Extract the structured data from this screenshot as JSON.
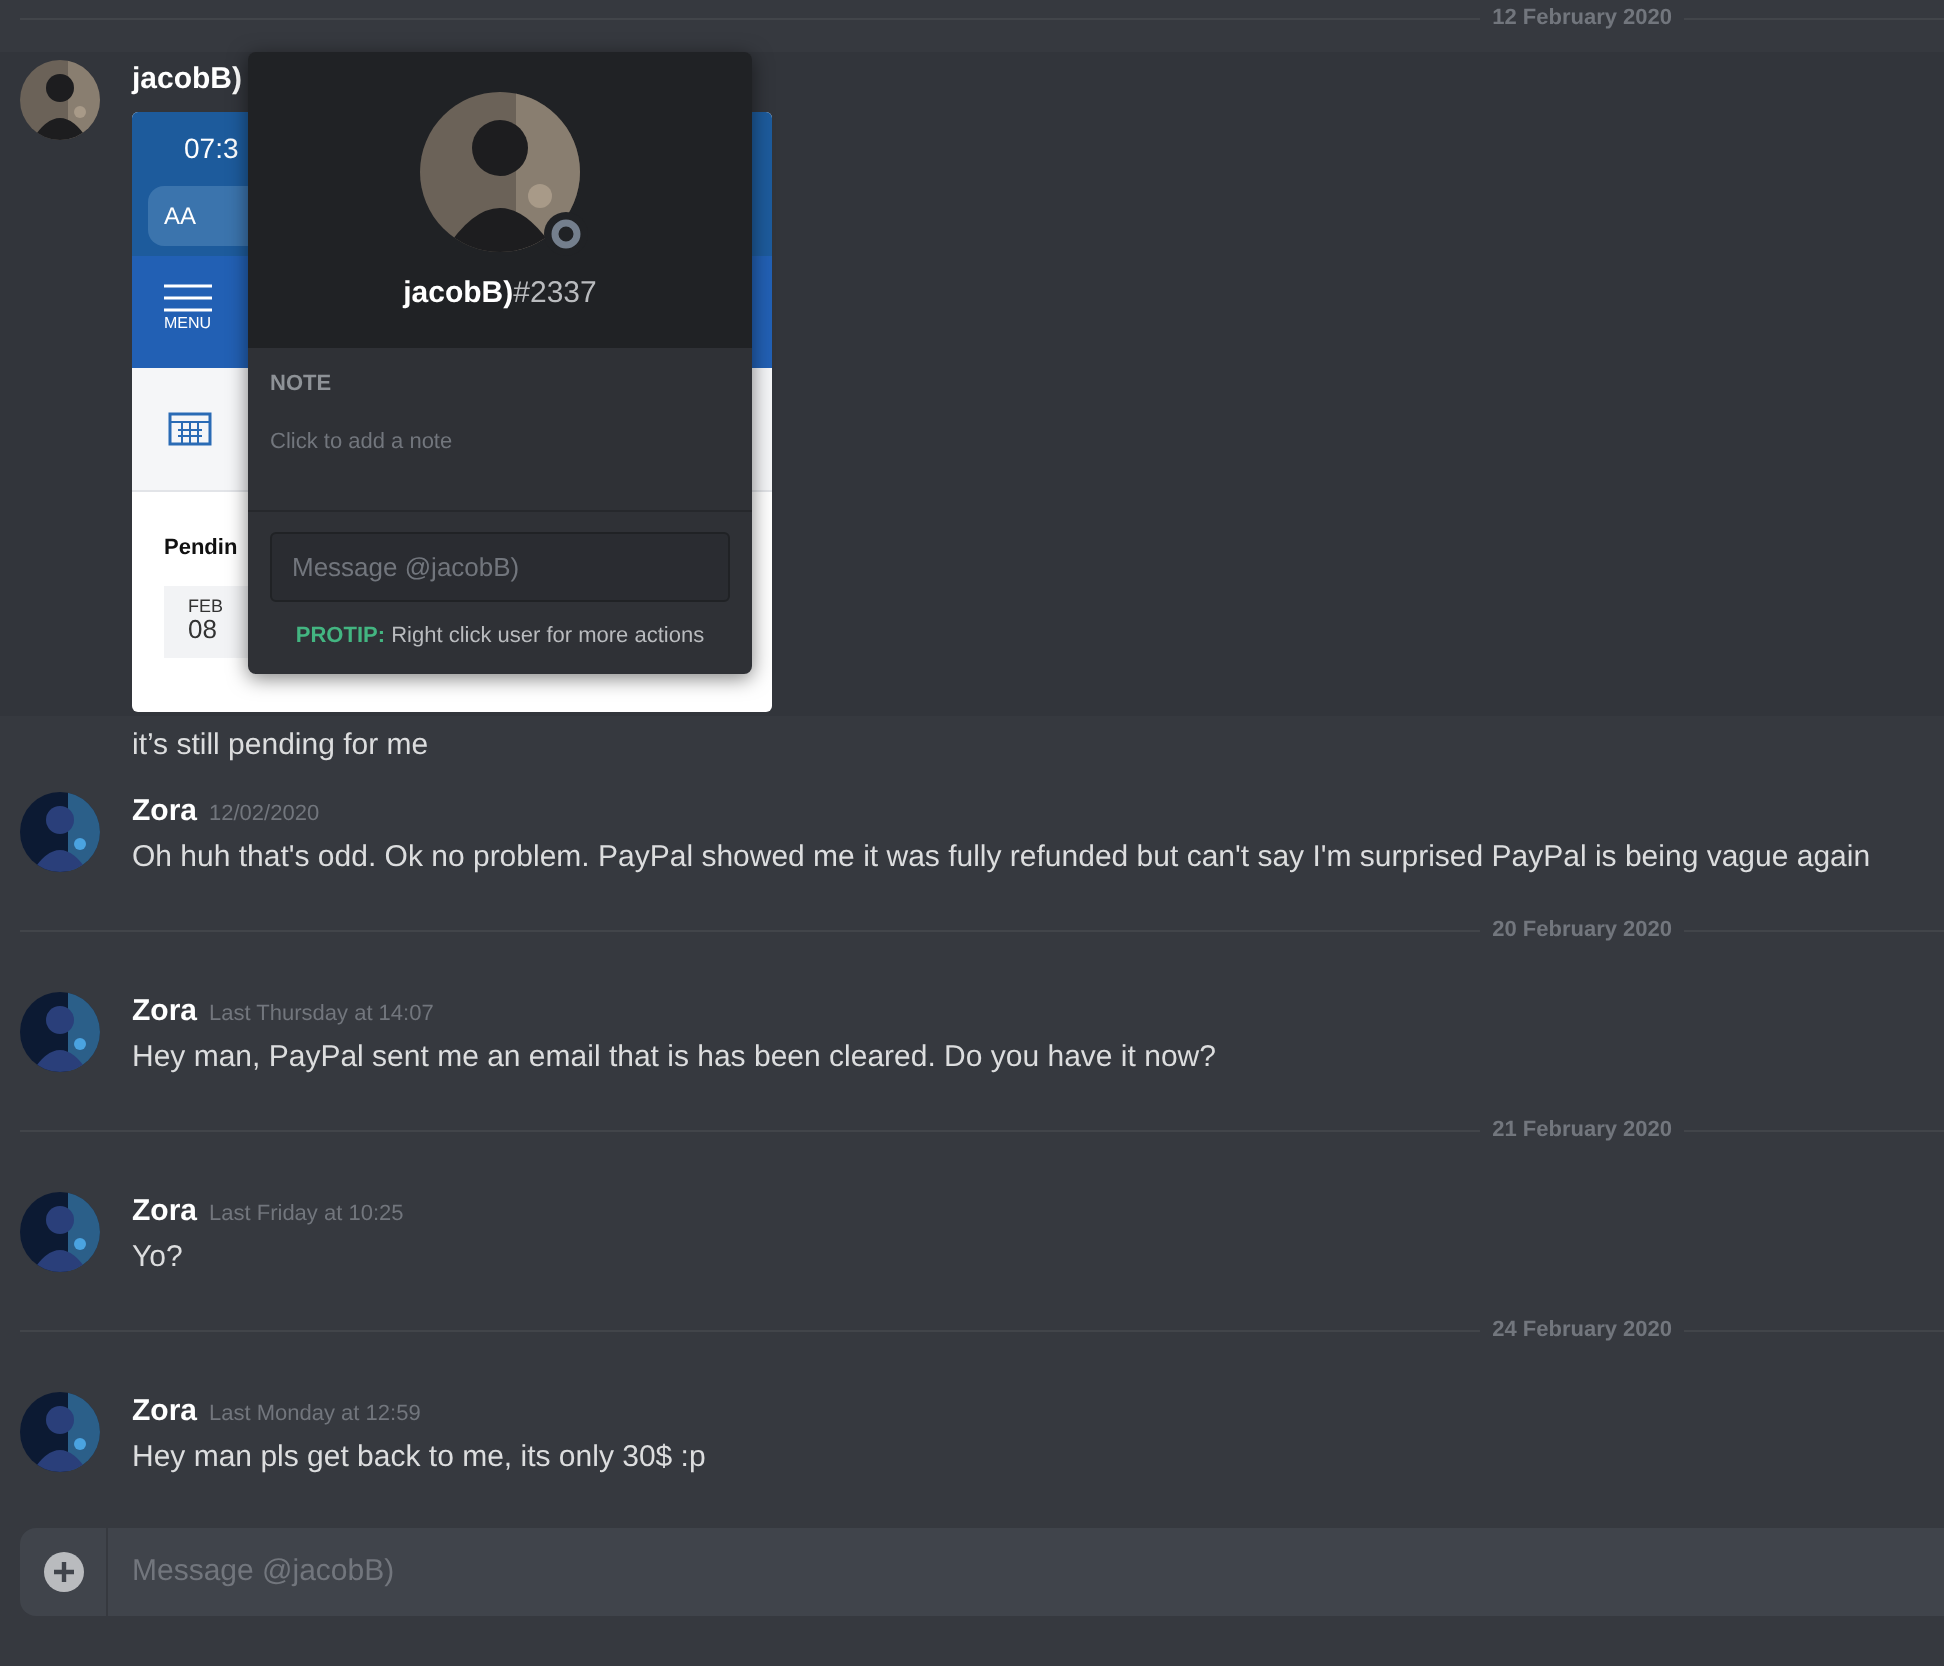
{
  "items": [
    {
      "kind": "divider",
      "label": "12 February 2020"
    },
    {
      "kind": "message",
      "author": "jacobB)",
      "hovered": true,
      "attachment": {
        "time": "07:3",
        "font_label": "AA",
        "menu_label": "MENU",
        "section_title": "Pendin",
        "month": "FEB",
        "day": "08"
      }
    },
    {
      "kind": "continuation",
      "text": "it’s still pending for me"
    },
    {
      "kind": "message",
      "author": "Zora",
      "timestamp": "12/02/2020",
      "text": "Oh huh that's odd. Ok no problem. PayPal showed me it was fully refunded but can't say I'm surprised PayPal is being vague again"
    },
    {
      "kind": "divider",
      "label": "20 February 2020"
    },
    {
      "kind": "message",
      "author": "Zora",
      "timestamp": "Last Thursday at 14:07",
      "text": "Hey man, PayPal sent me an email that is has been cleared. Do you have it now?"
    },
    {
      "kind": "divider",
      "label": "21 February 2020"
    },
    {
      "kind": "message",
      "author": "Zora",
      "timestamp": "Last Friday at 10:25",
      "text": "Yo?"
    },
    {
      "kind": "divider",
      "label": "24 February 2020"
    },
    {
      "kind": "message",
      "author": "Zora",
      "timestamp": "Last Monday at 12:59",
      "text": "Hey man pls get back to me, its only 30$ :p"
    }
  ],
  "profile_popup": {
    "username": "jacobB)",
    "tag": "#2337",
    "note_label": "NOTE",
    "note_placeholder": "Click to add a note",
    "message_placeholder": "Message @jacobB)",
    "protip_label": "PROTIP:",
    "protip_text": "Right click user for more actions"
  },
  "composer": {
    "placeholder": "Message @jacobB)"
  }
}
